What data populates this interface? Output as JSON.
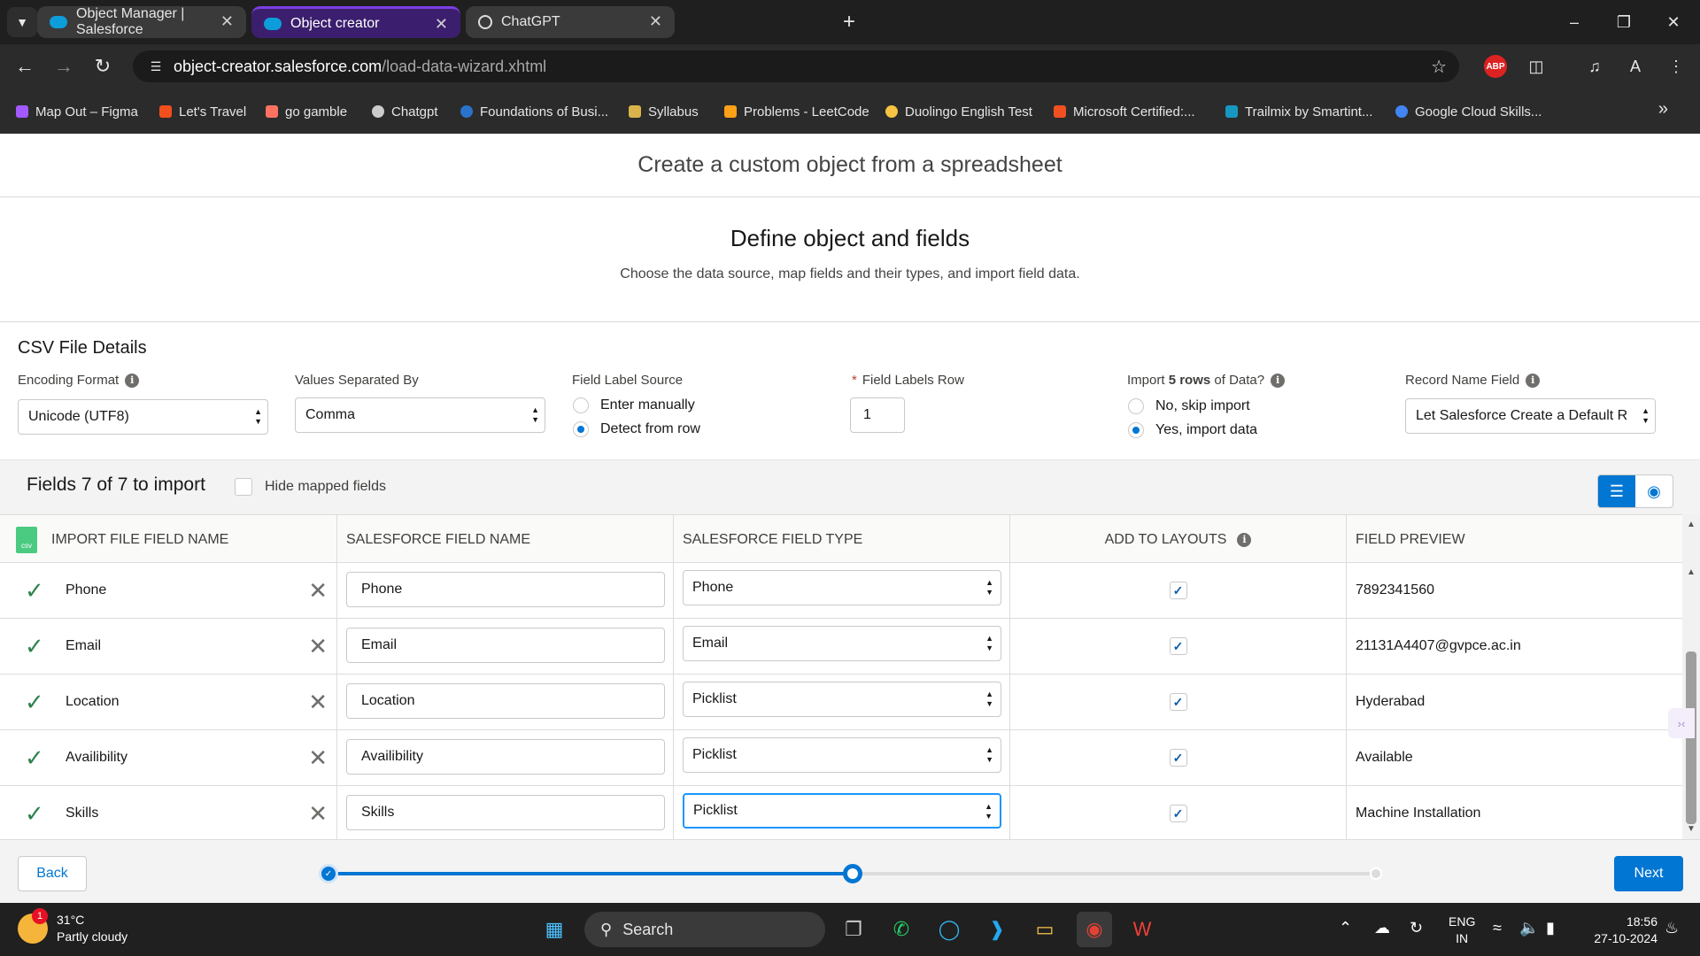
{
  "browser": {
    "tabs": [
      {
        "label": "Object Manager | Salesforce",
        "active": false
      },
      {
        "label": "Object creator",
        "active": true
      },
      {
        "label": "ChatGPT",
        "active": false
      }
    ],
    "url_host": "object-creator.salesforce.com",
    "url_path": "/load-data-wizard.xhtml",
    "bookmarks": [
      {
        "label": "Map Out – Figma",
        "color": "#a259ff"
      },
      {
        "label": "Let's Travel",
        "color": "#f24e1e"
      },
      {
        "label": "go gamble",
        "color": "#ff7262"
      },
      {
        "label": "Chatgpt",
        "color": "#cccccc"
      },
      {
        "label": "Foundations of Busi...",
        "color": "#2a73cc"
      },
      {
        "label": "Syllabus",
        "color": "#d9b44a"
      },
      {
        "label": "Problems - LeetCode",
        "color": "#ffa116"
      },
      {
        "label": "Duolingo English Test",
        "color": "#f6c342"
      },
      {
        "label": "Microsoft Certified:...",
        "color": "#f25022"
      },
      {
        "label": "Trailmix by Smartint...",
        "color": "#1798c1"
      },
      {
        "label": "Google Cloud Skills...",
        "color": "#4285f4"
      }
    ]
  },
  "page": {
    "header": "Create a custom object from a spreadsheet",
    "step_title": "Define object and fields",
    "step_subtitle": "Choose the data source, map fields and their types, and import field data."
  },
  "csv": {
    "title": "CSV File Details",
    "encoding_label": "Encoding Format",
    "encoding_value": "Unicode (UTF8)",
    "separator_label": "Values Separated By",
    "separator_value": "Comma",
    "label_source_label": "Field Label Source",
    "label_source_options": [
      "Enter manually",
      "Detect from row"
    ],
    "label_source_selected": 1,
    "labels_row_label": "Field Labels Row",
    "labels_row_value": "1",
    "import_label_pre": "Import ",
    "import_label_bold": "5 rows",
    "import_label_post": " of Data?",
    "import_options": [
      "No, skip import",
      "Yes, import data"
    ],
    "import_selected": 1,
    "record_name_label": "Record Name Field",
    "record_name_value": "Let Salesforce Create a Default R"
  },
  "fields": {
    "count_label": "Fields 7 of 7 to import",
    "hide_mapped_label": "Hide mapped fields",
    "columns": [
      "IMPORT FILE FIELD NAME",
      "SALESFORCE FIELD NAME",
      "SALESFORCE FIELD TYPE",
      "ADD TO LAYOUTS",
      "FIELD PREVIEW"
    ],
    "csv_icon_text": "csv",
    "rows": [
      {
        "import_name": "Phone",
        "sf_name": "Phone",
        "sf_type": "Phone",
        "add_to_layout": true,
        "preview": "7892341560"
      },
      {
        "import_name": "Email",
        "sf_name": "Email",
        "sf_type": "Email",
        "add_to_layout": true,
        "preview": "21131A4407@gvpce.ac.in"
      },
      {
        "import_name": "Location",
        "sf_name": "Location",
        "sf_type": "Picklist",
        "add_to_layout": true,
        "preview": "Hyderabad"
      },
      {
        "import_name": "Availibility",
        "sf_name": "Availibility",
        "sf_type": "Picklist",
        "add_to_layout": true,
        "preview": "Available"
      },
      {
        "import_name": "Skills",
        "sf_name": "Skills",
        "sf_type": "Picklist",
        "add_to_layout": true,
        "preview": "Machine Installation"
      }
    ]
  },
  "footer": {
    "back_label": "Back",
    "next_label": "Next",
    "progress_steps": 3,
    "current_step": 2
  },
  "taskbar": {
    "temp": "31°C",
    "weather": "Partly cloudy",
    "weather_badge": "1",
    "search_label": "Search",
    "lang_top": "ENG",
    "lang_bottom": "IN",
    "time": "18:56",
    "date": "27-10-2024"
  },
  "colors": {
    "brand": "#0176d3",
    "success": "#2e844a",
    "active_tab": "#3b1f6e"
  }
}
